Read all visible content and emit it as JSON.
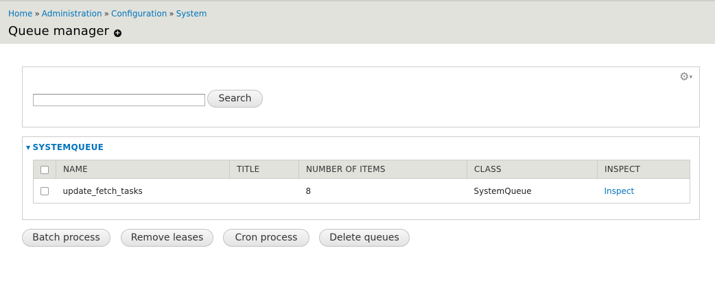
{
  "breadcrumb": {
    "items": [
      "Home",
      "Administration",
      "Configuration",
      "System"
    ],
    "separator": "»"
  },
  "page": {
    "title": "Queue manager",
    "shortcut_icon": "plus-circle-icon"
  },
  "filter": {
    "gear_icon": "gear-icon",
    "search_value": "",
    "search_button": "Search"
  },
  "queue_group": {
    "legend": "SYSTEMQUEUE",
    "table": {
      "columns": [
        "NAME",
        "TITLE",
        "NUMBER OF ITEMS",
        "CLASS",
        "INSPECT"
      ],
      "rows": [
        {
          "name": "update_fetch_tasks",
          "title": "",
          "items": "8",
          "class": "SystemQueue",
          "inspect": "Inspect"
        }
      ]
    }
  },
  "actions": {
    "batch_process": "Batch process",
    "remove_leases": "Remove leases",
    "cron_process": "Cron process",
    "delete_queues": "Delete queues"
  },
  "colors": {
    "link": "#0074bd",
    "header_bg": "#e1e2dc",
    "border": "#cccccc"
  }
}
